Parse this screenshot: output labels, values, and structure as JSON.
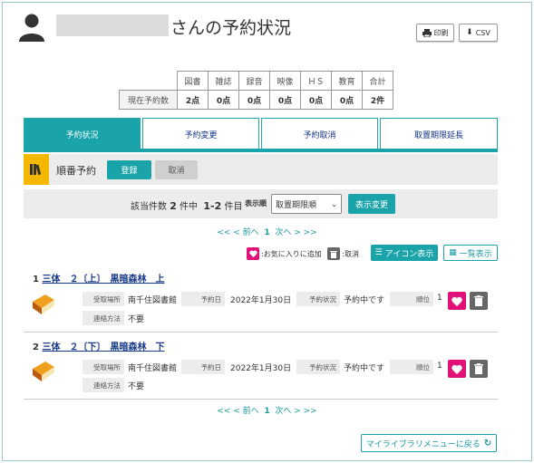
{
  "header": {
    "title": "さんの予約状況",
    "print_label": "印刷",
    "csv_label": "CSV"
  },
  "stats": {
    "row_header": "現在予約数",
    "columns": [
      "図書",
      "雑誌",
      "録音",
      "映像",
      "ＨＳ",
      "教育",
      "合計"
    ],
    "values": [
      "2点",
      "0点",
      "0点",
      "0点",
      "0点",
      "0点",
      "2件"
    ]
  },
  "tabs": [
    {
      "label": "予約状況",
      "active": true
    },
    {
      "label": "予約変更",
      "active": false
    },
    {
      "label": "予約取消",
      "active": false
    },
    {
      "label": "取置期限延長",
      "active": false
    }
  ],
  "order": {
    "label": "順番予約",
    "register_label": "登録",
    "cancel_label": "取消"
  },
  "results": {
    "count_prefix": "該当件数",
    "count_value": "2",
    "count_mid": "件中",
    "range": "1-2",
    "range_suffix": "件目",
    "display_label": "表示順",
    "sort_selected": "取置期限順",
    "display_change_label": "表示変更"
  },
  "pager": {
    "prev": "<< < 前へ",
    "current": "1",
    "next": "次へ > >>"
  },
  "legend": {
    "favorite": ":お気に入りに追加",
    "remove": ":取消"
  },
  "view": {
    "icon_view": "アイコン表示",
    "list_view": "一覧表示"
  },
  "fields": {
    "pickup": "受取場所",
    "reserve_date": "予約日",
    "status": "予約状況",
    "rank": "順位",
    "contact": "連絡方法"
  },
  "items": [
    {
      "num": "1",
      "title": "三体　２〔上〕　黒暗森林　上",
      "pickup": "南千住図書館",
      "date": "2022年1月30日",
      "status": "予約中です",
      "rank": "1",
      "contact": "不要"
    },
    {
      "num": "2",
      "title": "三体　２〔下〕　黒暗森林　下",
      "pickup": "南千住図書館",
      "date": "2022年1月30日",
      "status": "予約中です",
      "rank": "1",
      "contact": "不要"
    }
  ],
  "footer": {
    "back_label": "マイライブラリメニューに戻る"
  },
  "colors": {
    "accent": "#1aa3a9",
    "favorite": "#e0127a",
    "order_icon": "#f5b800"
  }
}
